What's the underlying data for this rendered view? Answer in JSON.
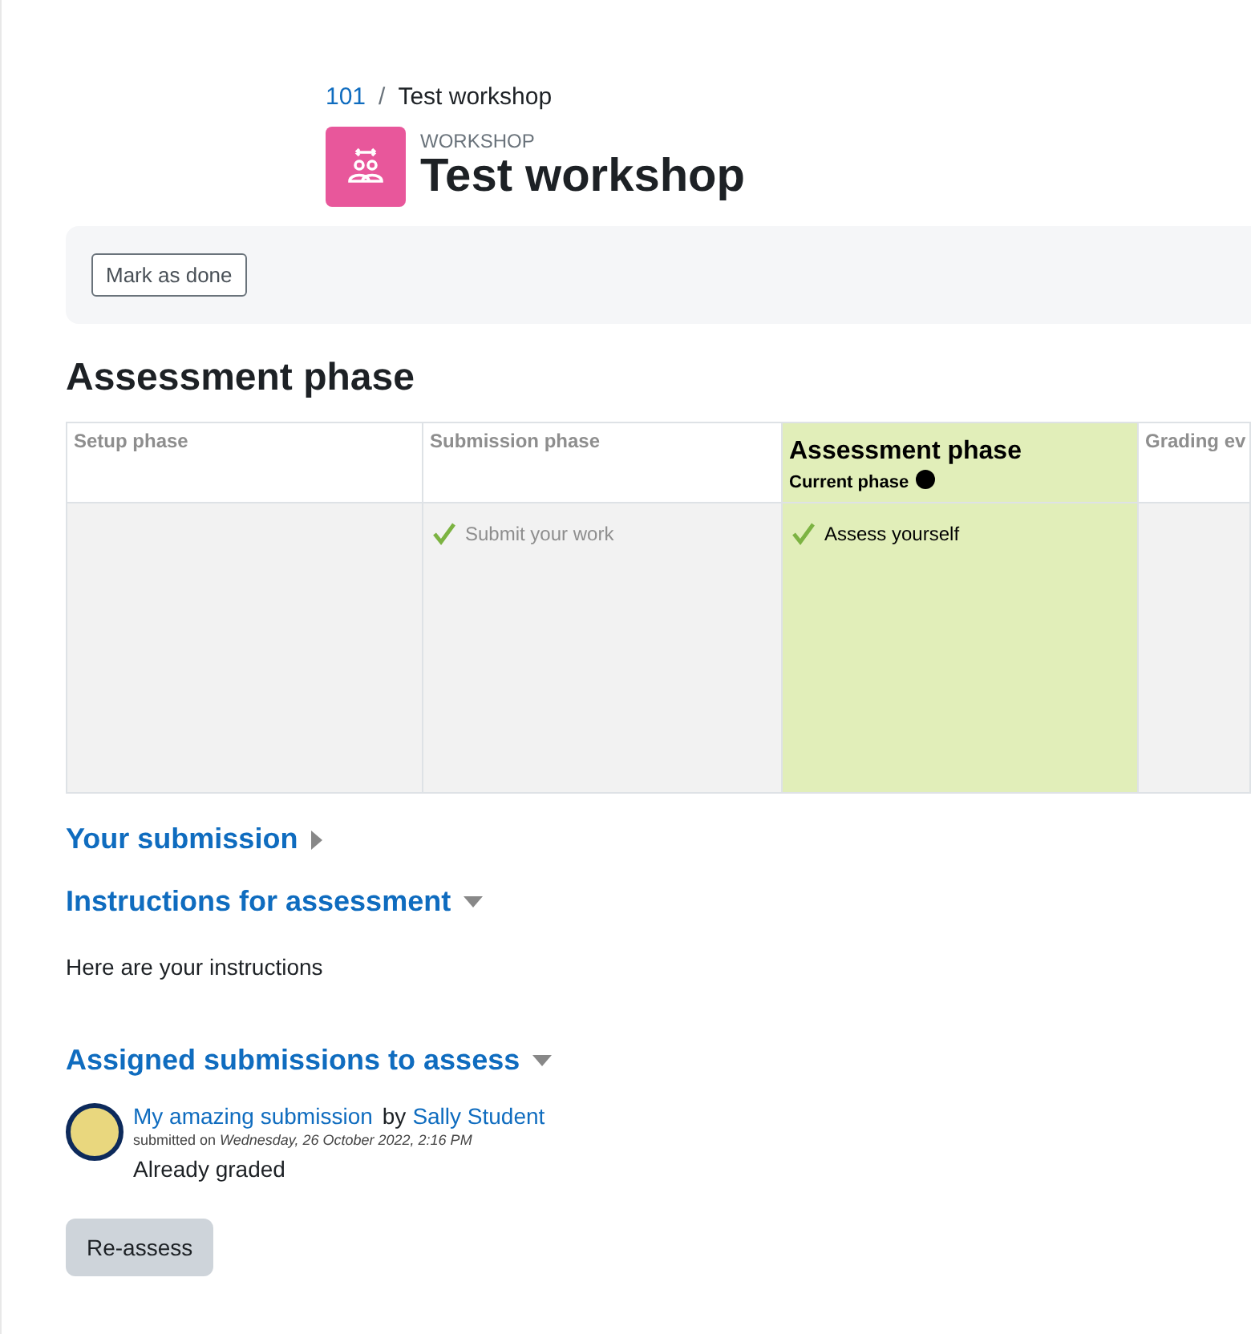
{
  "breadcrumb": [
    {
      "label": "101",
      "kind": "link"
    },
    {
      "label": "/",
      "kind": "separator"
    },
    {
      "label": "Test workshop",
      "kind": "current"
    }
  ],
  "activity": {
    "type_label": "WORKSHOP",
    "title": "Test workshop"
  },
  "completion": {
    "button": "Mark as done"
  },
  "phase_heading": "Assessment phase",
  "phases": [
    {
      "title": "Setup phase",
      "selected": false
    },
    {
      "title": "Submission phase",
      "selected": false,
      "tasks": [
        {
          "label": "Submit your work",
          "done": true
        }
      ]
    },
    {
      "title": "Assessment phase",
      "selected": true,
      "current_label": "Current phase",
      "tasks": [
        {
          "label": "Assess yourself",
          "done": true
        }
      ]
    },
    {
      "title": "Grading ev",
      "selected": false
    }
  ],
  "sections": [
    {
      "title": "Your submission",
      "expanded": false
    },
    {
      "title": "Instructions for assessment",
      "expanded": true,
      "text": "Here are your instructions"
    },
    {
      "title": "Assigned submissions to assess",
      "expanded": true,
      "submissions": [
        {
          "title": "My amazing submission",
          "by": "by",
          "author": "Sally Student",
          "submitted_label": "submitted on",
          "date": "Wednesday, 26 October 2022, 2:16 PM",
          "status": "Already graded",
          "button": "Re-assess"
        }
      ]
    }
  ]
}
